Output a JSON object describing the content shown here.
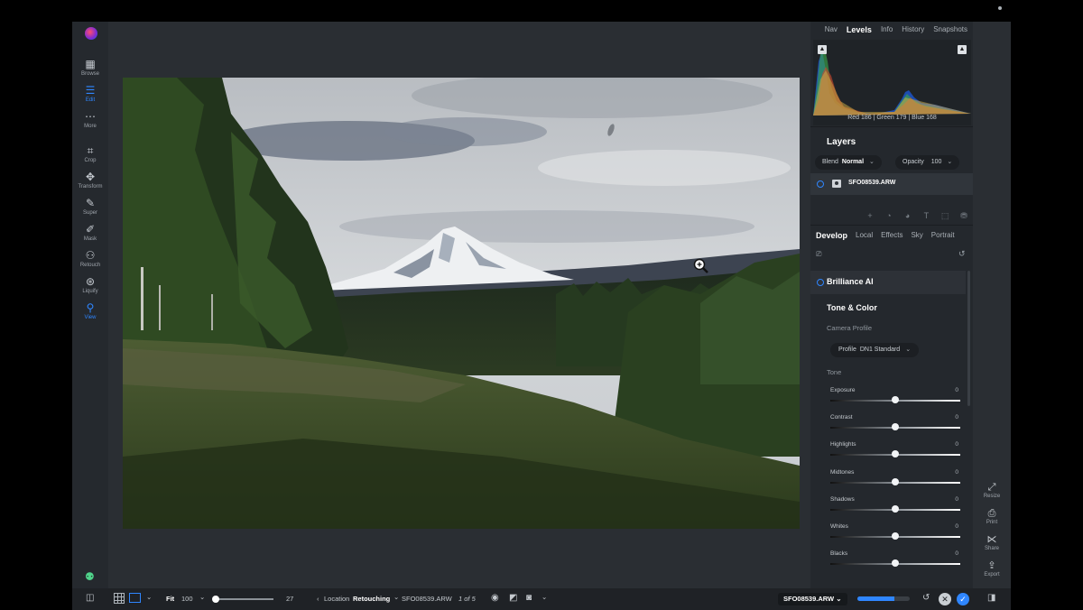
{
  "left_toolbar": {
    "tools": [
      {
        "label": "Browse",
        "icon": "grid-icon",
        "glyph": "▦"
      },
      {
        "label": "Edit",
        "icon": "sliders-icon",
        "glyph": "☰"
      },
      {
        "label": "More",
        "icon": "more-icon",
        "glyph": "⋯"
      },
      {
        "label": "Crop",
        "icon": "crop-icon",
        "glyph": "⌗"
      },
      {
        "label": "Transform",
        "icon": "move-icon",
        "glyph": "✥"
      },
      {
        "label": "Super",
        "icon": "brush-icon",
        "glyph": "✎"
      },
      {
        "label": "Mask",
        "icon": "mask-brush-icon",
        "glyph": "✐"
      },
      {
        "label": "Retouch",
        "icon": "retouch-icon",
        "glyph": "⚇"
      },
      {
        "label": "Liquify",
        "icon": "liquify-icon",
        "glyph": "⊛"
      },
      {
        "label": "View",
        "icon": "zoom-icon",
        "glyph": "⚲"
      }
    ],
    "active_tools": [
      "Edit",
      "View"
    ]
  },
  "right_panel": {
    "tabs": [
      "Nav",
      "Levels",
      "Info",
      "History",
      "Snapshots"
    ],
    "active_tab": "Levels",
    "histogram_readout": "Red 186 | Green 179 | Blue 168",
    "layers": {
      "title": "Layers",
      "blend_label": "Blend",
      "blend_value": "Normal",
      "opacity_label": "Opacity",
      "opacity_value": "100",
      "items": [
        {
          "name": "SFO08539.ARW"
        }
      ],
      "tool_glyphs": [
        "+",
        "◔",
        "◕",
        "T",
        "⬚",
        "⛃"
      ]
    },
    "develop": {
      "tabs": [
        "Develop",
        "Local",
        "Effects",
        "Sky",
        "Portrait"
      ],
      "active_tab": "Develop",
      "brilliance": "Brilliance AI",
      "tone_color": "Tone & Color",
      "camera_profile_label": "Camera Profile",
      "profile_label": "Profile",
      "profile_value": "DN1 Standard",
      "tone_label": "Tone",
      "sliders": [
        {
          "name": "Exposure",
          "value": "0",
          "pos": 0.5
        },
        {
          "name": "Contrast",
          "value": "0",
          "pos": 0.5
        },
        {
          "name": "Highlights",
          "value": "0",
          "pos": 0.5
        },
        {
          "name": "Midtones",
          "value": "0",
          "pos": 0.5
        },
        {
          "name": "Shadows",
          "value": "0",
          "pos": 0.5
        },
        {
          "name": "Whites",
          "value": "0",
          "pos": 0.5
        },
        {
          "name": "Blacks",
          "value": "0",
          "pos": 0.5
        }
      ]
    }
  },
  "dock": {
    "items": [
      {
        "label": "Resize",
        "icon": "resize-icon",
        "glyph": "⤢"
      },
      {
        "label": "Print",
        "icon": "print-icon",
        "glyph": "⎙"
      },
      {
        "label": "Share",
        "icon": "share-icon",
        "glyph": "⋉"
      },
      {
        "label": "Export",
        "icon": "export-icon",
        "glyph": "⇪"
      }
    ]
  },
  "bottom_bar": {
    "fit_label": "Fit",
    "zoom_value": "100",
    "zoom_chevron": "⌄",
    "thumb_size": "27",
    "location_label": "Location",
    "location_value": "Retouching",
    "filename": "SFO08539.ARW",
    "counter": "1 of 5",
    "current_file": "SFO08539.ARW",
    "progress": 0.7,
    "cancel_glyph": "✕",
    "apply_glyph": "✓"
  },
  "colors": {
    "accent": "#2f86ff",
    "panel": "#24282d",
    "app_bg": "#2a2e33"
  }
}
